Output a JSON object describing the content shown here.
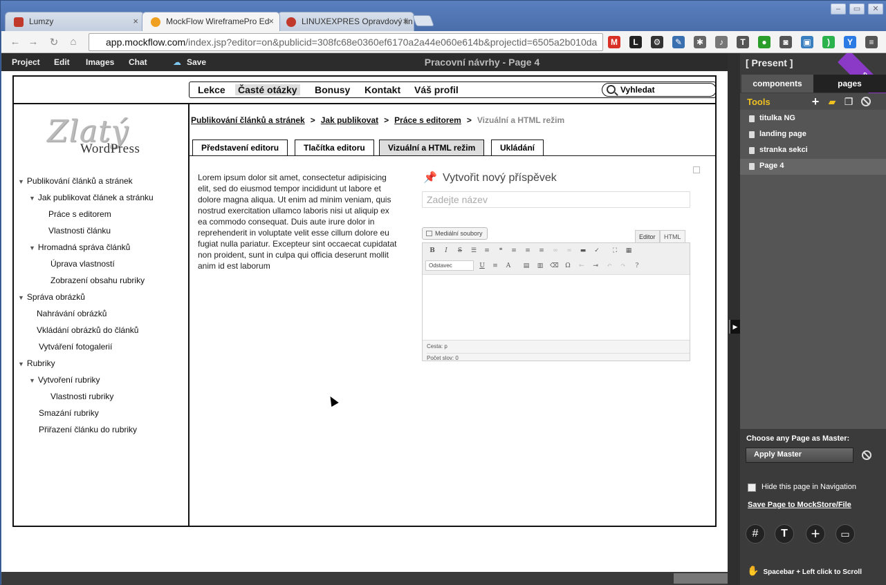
{
  "browser": {
    "tabs": [
      {
        "title": "Lumzy",
        "icon_color": "#c0392b"
      },
      {
        "title": "MockFlow WireframePro Ed",
        "icon_color": "#f0a020"
      },
      {
        "title": "LINUXEXPRES Opravdový lin",
        "icon_color": "#c0392b"
      }
    ],
    "close_glyph": "×",
    "url_domain": "app.mockflow.com",
    "url_path": "/index.jsp?editor=on&publicid=308fc68e0360ef6170a2a44e060e614b&projectid=6505a2b010da",
    "window_buttons": [
      "–",
      "▭",
      "✕"
    ],
    "extensions": [
      {
        "name": "gmail-icon",
        "label": "M",
        "color": "#d93025"
      },
      {
        "name": "l-icon",
        "label": "L",
        "color": "#222"
      },
      {
        "name": "gear-icon",
        "label": "⚙",
        "color": "#333"
      },
      {
        "name": "eyedropper-icon",
        "label": "✎",
        "color": "#3a6fb0"
      },
      {
        "name": "bug-icon",
        "label": "✱",
        "color": "#666"
      },
      {
        "name": "bell-icon",
        "label": "♪",
        "color": "#777"
      },
      {
        "name": "tag-icon",
        "label": "T",
        "color": "#555"
      },
      {
        "name": "evernote-icon",
        "label": "●",
        "color": "#2a9d2a"
      },
      {
        "name": "camera-icon",
        "label": "◙",
        "color": "#555"
      },
      {
        "name": "screenshot-icon",
        "label": "▣",
        "color": "#3a7fc0"
      },
      {
        "name": "feedly-icon",
        "label": ")",
        "color": "#2bb24c"
      },
      {
        "name": "pushbullet-icon",
        "label": "Y",
        "color": "#2c7be5"
      },
      {
        "name": "menu-icon",
        "label": "≡",
        "color": "#555"
      }
    ]
  },
  "menubar": {
    "items": [
      "Project",
      "Edit",
      "Images",
      "Chat",
      "Save"
    ],
    "page_title": "Pracovní návrhy - Page 4"
  },
  "wireframe": {
    "topnav": [
      "Lekce",
      "Časté otázky",
      "Bonusy",
      "Kontakt",
      "Váš profil"
    ],
    "search_label": "Vyhledat",
    "logo": {
      "line1": "Zlatý",
      "line2": "WordPress"
    },
    "tree": [
      {
        "label": "Publikování článků a stránek",
        "arrow": true
      },
      {
        "label": "Jak publikovat článek a stránku",
        "arrow": true
      },
      {
        "label": "Práce s editorem",
        "arrow": false
      },
      {
        "label": "Vlastnosti článku",
        "arrow": false
      },
      {
        "label": "Hromadná správa článků",
        "arrow": true
      },
      {
        "label": "Úprava vlastností",
        "arrow": false
      },
      {
        "label": "Zobrazení obsahu rubriky",
        "arrow": false
      },
      {
        "label": "Správa obrázků",
        "arrow": true
      },
      {
        "label": "Nahrávání obrázků",
        "arrow": false
      },
      {
        "label": "Vkládání obrázků do článků",
        "arrow": false
      },
      {
        "label": "Vytváření fotogalerií",
        "arrow": false
      },
      {
        "label": "Rubriky",
        "arrow": true
      },
      {
        "label": "Vytvoření rubriky",
        "arrow": true
      },
      {
        "label": "Vlastnosti rubriky",
        "arrow": false
      },
      {
        "label": "Smazání rubriky",
        "arrow": false
      },
      {
        "label": "Přiřazení článku do rubriky",
        "arrow": false
      }
    ],
    "breadcrumb": {
      "links": [
        "Publikování článků a stránek",
        "Jak publikovat",
        "Práce s editorem"
      ],
      "separator": ">",
      "current": "Vizuální a HTML režim"
    },
    "subtabs": [
      "Představení editoru",
      "Tlačítka editoru",
      "Vizuální a HTML režim",
      "Ukládání"
    ],
    "lorem": "Lorem ipsum dolor sit amet, consectetur adipisicing elit, sed do eiusmod tempor incididunt ut labore et dolore magna aliqua. Ut enim ad minim veniam, quis nostrud exercitation ullamco laboris nisi ut aliquip ex ea commodo consequat. Duis aute irure dolor in reprehenderit in voluptate velit esse cillum dolore eu fugiat nulla pariatur. Excepteur sint occaecat cupidatat non proident, sunt in culpa qui officia deserunt mollit anim id est laborum",
    "wp_editor": {
      "heading": "Vytvořit nový příspěvek",
      "title_placeholder": "Zadejte název",
      "media_button": "Mediální soubory",
      "tab_editor": "Editor",
      "tab_html": "HTML",
      "format_select": "Odstavec",
      "path_label": "Cesta: p",
      "word_count": "Počet slov: 0"
    }
  },
  "right_panel": {
    "present": "[ Present ]",
    "store": "Store",
    "tabs": [
      "components",
      "pages"
    ],
    "tools_label": "Tools",
    "pages": [
      "titulka NG",
      "landing page",
      "stranka sekci",
      "Page 4"
    ],
    "selected_page": "Page 4",
    "master_label": "Choose any Page as Master:",
    "apply_master": "Apply Master",
    "hide_label": "Hide this page in Navigation",
    "save_link": "Save Page to MockStore/File",
    "scroll_hint": "Spacebar + Left click to Scroll"
  }
}
